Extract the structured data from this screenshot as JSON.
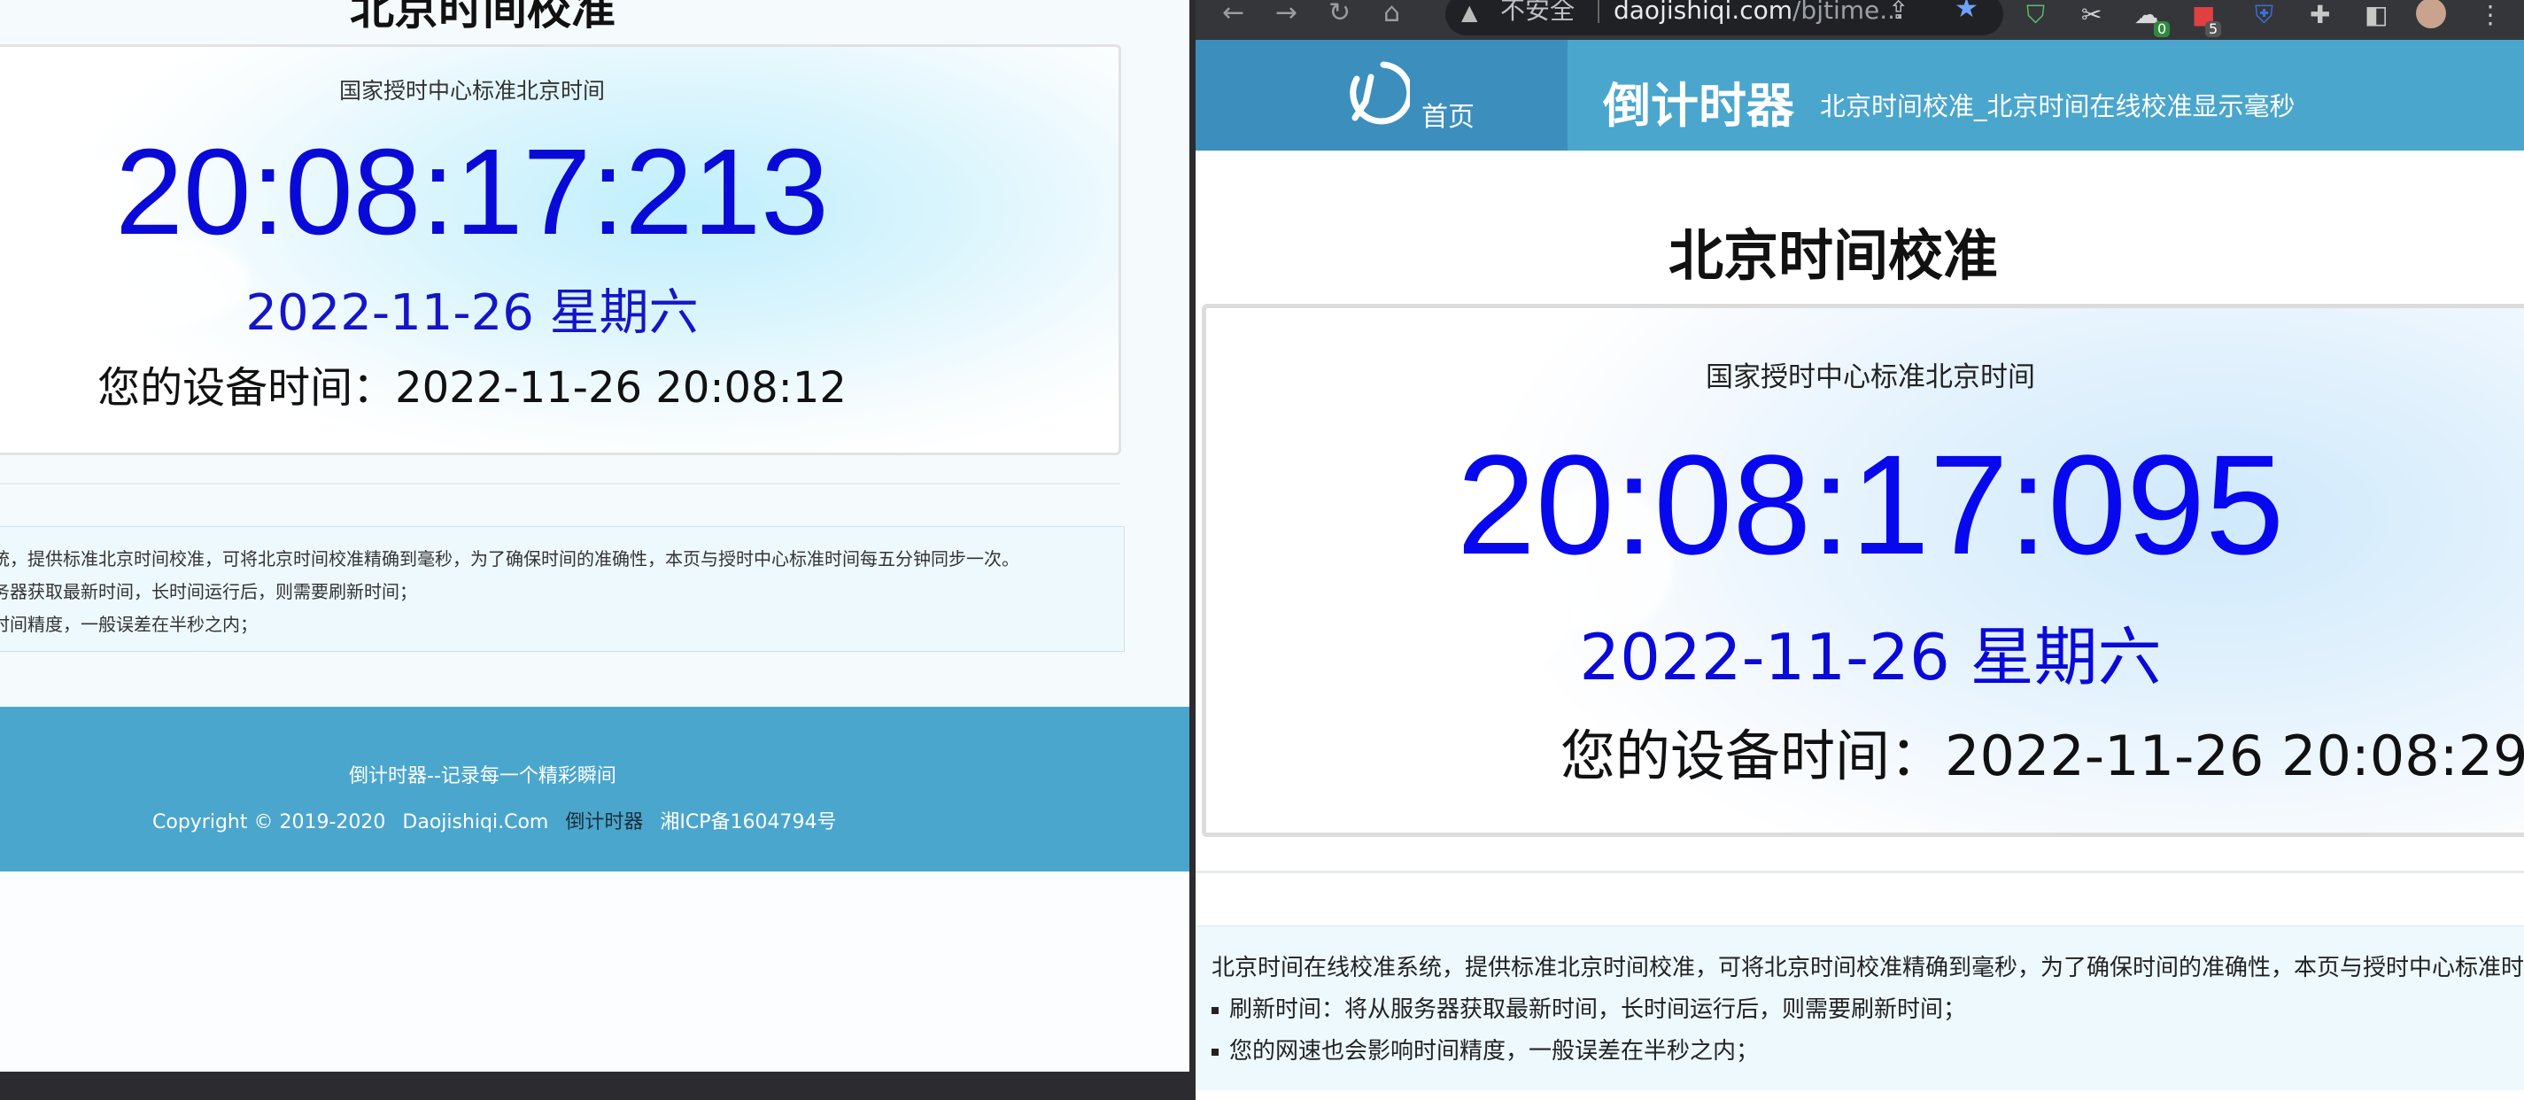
{
  "left_window": {
    "title": "北京时间校准",
    "subtitle": "国家授时中心标准北京时间",
    "time": "20:08:17:213",
    "date": "2022-11-26 星期六",
    "device_time": "您的设备时间：2022-11-26 20:08:12",
    "info_lines": [
      "统，提供标准北京时间校准，可将北京时间校准精确到毫秒，为了确保时间的准确性，本页与授时中心标准时间每五分钟同步一次。",
      "务器获取最新时间，长时间运行后，则需要刷新时间；",
      "时间精度，一般误差在半秒之内；"
    ],
    "footer": {
      "slogan": "倒计时器--记录每一个精彩瞬间",
      "copyright": "Copyright © 2019-2020",
      "site": "Daojishiqi.Com",
      "brand": "倒计时器",
      "icp": "湘ICP备1604794号"
    }
  },
  "browser": {
    "insecure_label": "不安全",
    "url_host": "daojishiqi.com",
    "url_path": "/bjtime...",
    "extension_badges": [
      "0",
      "5"
    ],
    "icons": [
      "back-icon",
      "forward-icon",
      "reload-icon",
      "home-icon",
      "warning-icon",
      "share-icon",
      "star-icon",
      "shield-check-icon",
      "scissors-icon",
      "cloud-icon",
      "red-extension-icon",
      "bitwarden-icon",
      "puzzle-icon",
      "sidepanel-icon",
      "avatar",
      "menu-icon"
    ]
  },
  "right_window": {
    "nav": {
      "home_label": "首页"
    },
    "site_name": "倒计时器",
    "site_tagline": "北京时间校准_北京时间在线校准显示毫秒",
    "title": "北京时间校准",
    "subtitle": "国家授时中心标准北京时间",
    "time": "20:08:17:095",
    "date": "2022-11-26 星期六",
    "device_time": "您的设备时间：2022-11-26 20:08:29",
    "info_intro": "北京时间在线校准系统，提供标准北京时间校准，可将北京时间校准精确到毫秒，为了确保时间的准确性，本页与授时中心标准时",
    "info_items": [
      "刷新时间：将从服务器获取最新时间，长时间运行后，则需要刷新时间；",
      "您的网速也会影响时间精度，一般误差在半秒之内；"
    ]
  },
  "colors": {
    "time_blue": "#0808ee",
    "header_blue": "#4aa6cd",
    "home_block_blue": "#3c8fbd",
    "footer_blue": "#4aa6cd",
    "chrome_dark": "#35363a"
  }
}
